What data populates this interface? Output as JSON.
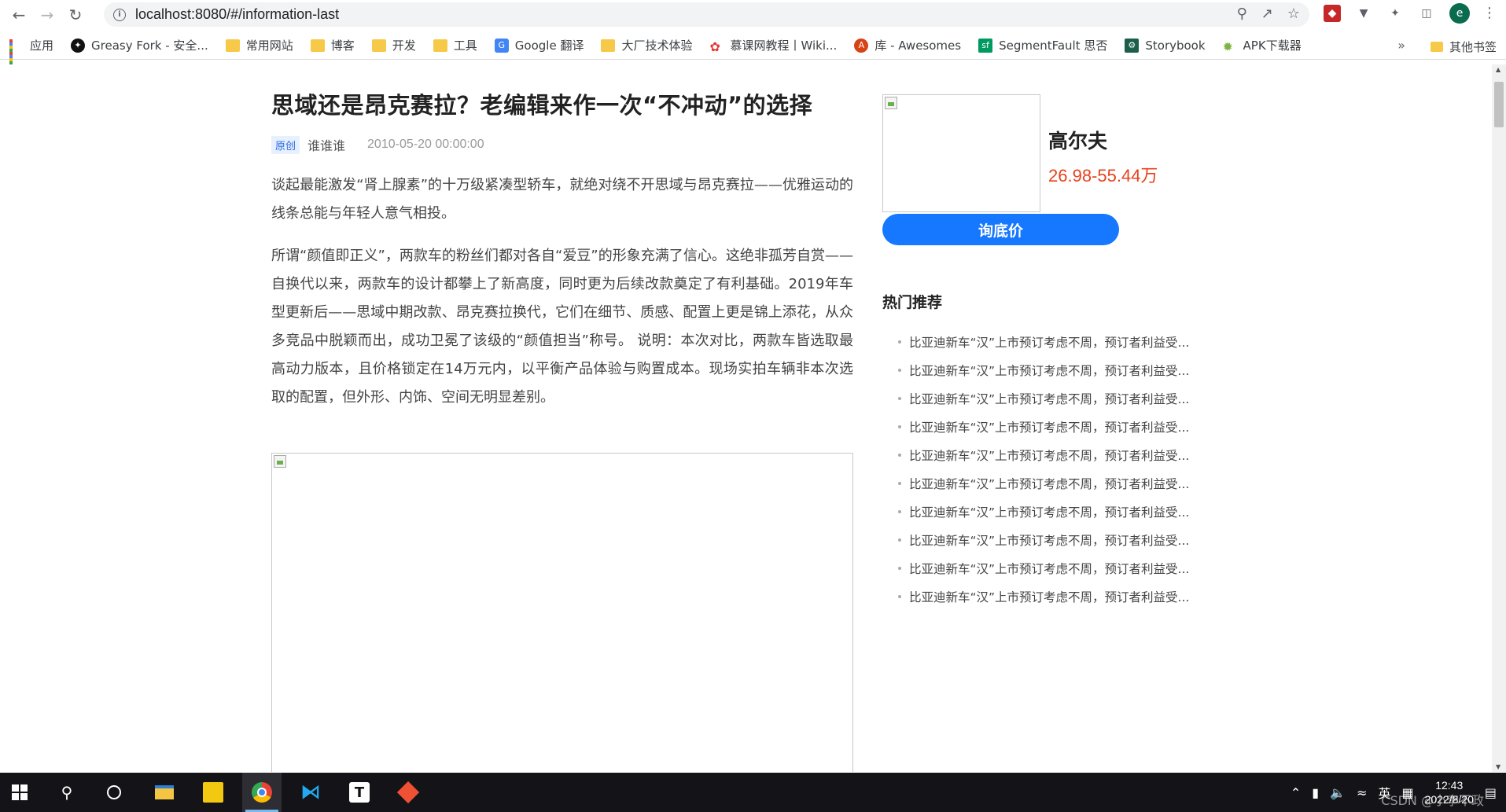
{
  "browser": {
    "url": "localhost:8080/#/information-last",
    "profile_initial": "e"
  },
  "bookmarks": [
    {
      "label": "应用",
      "icon": "apps-grid-icon"
    },
    {
      "label": "Greasy Fork - 安全...",
      "icon": "greasyfork-icon"
    },
    {
      "label": "常用网站",
      "icon": "folder-icon"
    },
    {
      "label": "博客",
      "icon": "folder-icon"
    },
    {
      "label": "开发",
      "icon": "folder-icon"
    },
    {
      "label": "工具",
      "icon": "folder-icon"
    },
    {
      "label": "Google 翻译",
      "icon": "google-translate-icon"
    },
    {
      "label": "大厂技术体验",
      "icon": "folder-icon"
    },
    {
      "label": "慕课网教程丨Wiki...",
      "icon": "imooc-icon"
    },
    {
      "label": "库 - Awesomes",
      "icon": "awesomes-icon"
    },
    {
      "label": "SegmentFault 思否",
      "icon": "segmentfault-icon"
    },
    {
      "label": "Storybook",
      "icon": "storybook-icon"
    },
    {
      "label": "APK下载器",
      "icon": "android-icon"
    }
  ],
  "bookmarks_more": "»",
  "bookmarks_other": "其他书签",
  "article": {
    "title": "思域还是昂克赛拉？老编辑来作一次“不冲动”的选择",
    "badge": "原创",
    "author": "谁谁谁",
    "date": "2010-05-20 00:00:00",
    "paragraphs": [
      "谈起最能激发“肾上腺素”的十万级紧凑型轿车，就绝对绕不开思域与昂克赛拉——优雅运动的线条总能与年轻人意气相投。",
      "所谓“颜值即正义”，两款车的粉丝们都对各自“爱豆”的形象充满了信心。这绝非孤芳自赏——自换代以来，两款车的设计都攀上了新高度，同时更为后续改款奠定了有利基础。2019年车型更新后——思域中期改款、昂克赛拉换代，它们在细节、质感、配置上更是锦上添花，从众多竞品中脱颖而出，成功卫冕了该级的“颜值担当”称号。 说明：本次对比，两款车皆选取最高动力版本，且价格锁定在14万元内，以平衡产品体验与购置成本。现场实拍车辆非本次选取的配置，但外形、内饰、空间无明显差别。"
    ]
  },
  "sidebar": {
    "car_name": "高尔夫",
    "car_price": "26.98-55.44万",
    "inquiry_button": "询底价",
    "hot_title": "热门推荐",
    "hot_items": [
      "比亚迪新车“汉”上市预订考虑不周，预订者利益受...",
      "比亚迪新车“汉”上市预订考虑不周，预订者利益受...",
      "比亚迪新车“汉”上市预订考虑不周，预订者利益受...",
      "比亚迪新车“汉”上市预订考虑不周，预订者利益受...",
      "比亚迪新车“汉”上市预订考虑不周，预订者利益受...",
      "比亚迪新车“汉”上市预订考虑不周，预订者利益受...",
      "比亚迪新车“汉”上市预订考虑不周，预订者利益受...",
      "比亚迪新车“汉”上市预订考虑不周，预订者利益受...",
      "比亚迪新车“汉”上市预订考虑不周，预订者利益受...",
      "比亚迪新车“汉”上市预订考虑不周，预订者利益受..."
    ]
  },
  "taskbar": {
    "ime": "英",
    "time": "12:43",
    "date": "2022/8/20",
    "watermark": "CSDN @小李不政"
  },
  "colors": {
    "accent_blue": "#1677ff",
    "price_red": "#e8421c"
  }
}
